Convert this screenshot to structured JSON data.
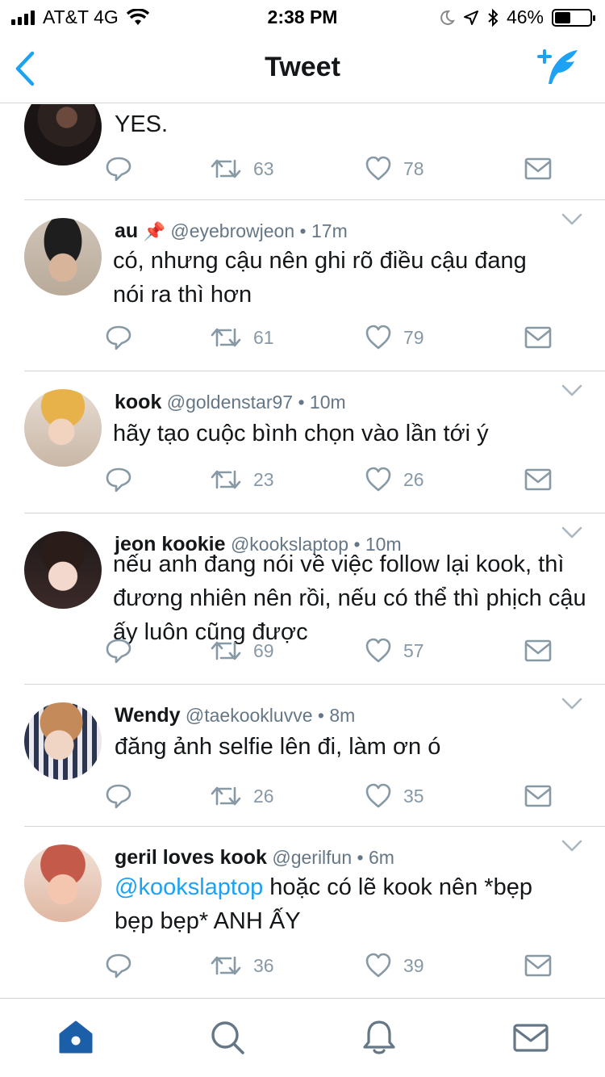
{
  "status_bar": {
    "carrier": "AT&T",
    "network": "4G",
    "time": "2:38 PM",
    "battery": "46%",
    "battery_level": 0.46,
    "icons": [
      "signal-icon",
      "wifi-icon",
      "moon-icon",
      "location-icon",
      "bluetooth-icon",
      "battery-icon"
    ]
  },
  "navbar": {
    "title": "Tweet",
    "back_icon": "chevron-left-icon",
    "compose_icon": "compose-tweet-icon"
  },
  "colors": {
    "accent": "#1da1f2",
    "text": "#14171a",
    "muted": "#8899a6",
    "divider": "#d6d6d6",
    "tab_active": "#1b5fa8"
  },
  "tweets": [
    {
      "name": "",
      "handle": "",
      "time": "",
      "text": "YES.",
      "replies": "",
      "retweets": "63",
      "likes": "78"
    },
    {
      "name": "au",
      "emoji": "📌",
      "handle": "@eyebrowjeon",
      "time": "• 17m",
      "text": "có, nhưng cậu nên ghi rõ điều cậu đang nói ra thì hơn",
      "retweets": "61",
      "likes": "79"
    },
    {
      "name": "kook",
      "handle": "@goldenstar97",
      "time": "• 10m",
      "text": "hãy tạo cuộc bình chọn vào lần tới ý",
      "retweets": "23",
      "likes": "26"
    },
    {
      "name": "jeon kookie",
      "handle": "@kookslaptop",
      "time": "• 10m",
      "text": "nếu anh đang nói về việc follow lại kook, thì đương nhiên nên rồi, nếu có thể thì phịch cậu ấy luôn cũng được",
      "retweets": "69",
      "likes": "57"
    },
    {
      "name": "Wendy",
      "handle": "@taekookluvve",
      "time": "• 8m",
      "text": "đăng ảnh selfie lên đi, làm ơn ó",
      "retweets": "26",
      "likes": "35"
    },
    {
      "name": "geril loves kook",
      "handle": "@gerilfun",
      "time": "• 6m",
      "mention": "@kookslaptop",
      "text": " hoặc có lẽ kook nên *bẹp bẹp bẹp* ANH ẤY",
      "retweets": "36",
      "likes": "39"
    }
  ],
  "tabbar": {
    "items": [
      "home-icon",
      "search-icon",
      "notifications-icon",
      "messages-icon"
    ],
    "active": "home-icon"
  }
}
